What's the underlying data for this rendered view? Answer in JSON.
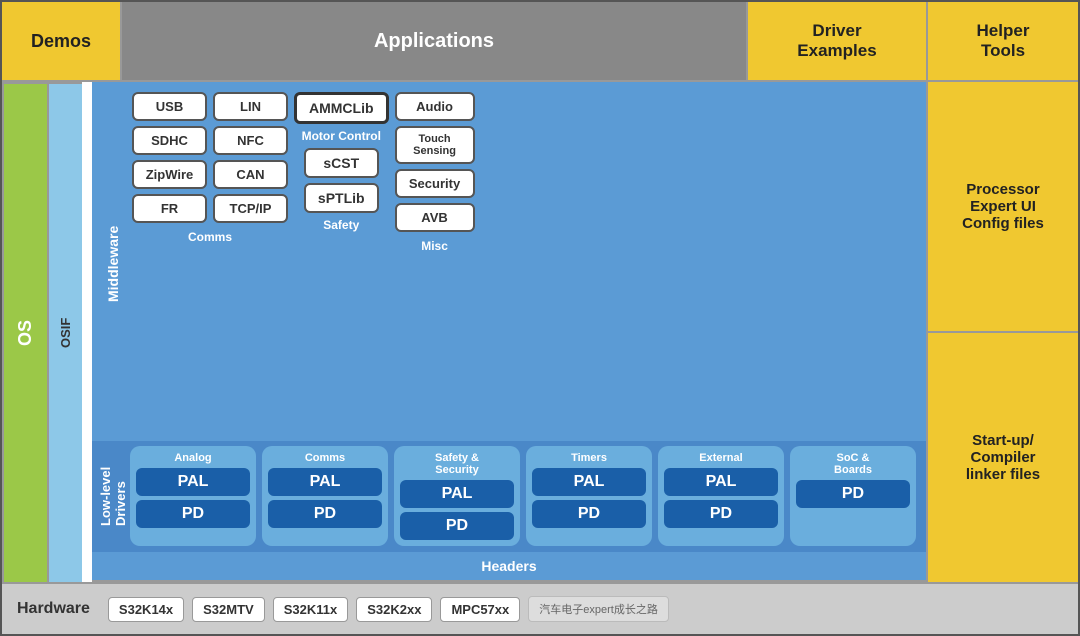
{
  "top": {
    "demos": "Demos",
    "applications": "Applications",
    "driver_examples": "Driver\nExamples",
    "helper_tools": "Helper\nTools"
  },
  "left": {
    "os": "OS",
    "osif": "OSIF"
  },
  "middleware": {
    "label": "Middleware",
    "comms_left": [
      "USB",
      "SDHC",
      "ZipWire",
      "FR"
    ],
    "comms_right": [
      "LIN",
      "NFC",
      "CAN",
      "TCP/IP"
    ],
    "comms_label": "Comms",
    "ammclib": "AMMCLib",
    "motor_control": "Motor Control",
    "scst": "sCST",
    "sptlib": "sPTLib",
    "safety_label": "Safety",
    "audio": "Audio",
    "touch_sensing": "Touch\nSensing",
    "security": "Security",
    "avb": "AVB",
    "misc_label": "Misc"
  },
  "low_level": {
    "label": "Low-level\nDrivers",
    "groups": [
      {
        "name": "Analog",
        "has_pal": true,
        "has_pd": true
      },
      {
        "name": "Comms",
        "has_pal": true,
        "has_pd": true
      },
      {
        "name": "Safety &\nSecurity",
        "has_pal": true,
        "has_pd": true
      },
      {
        "name": "Timers",
        "has_pal": true,
        "has_pd": true
      },
      {
        "name": "External",
        "has_pal": true,
        "has_pd": true
      },
      {
        "name": "SoC &\nBoards",
        "has_pal": false,
        "has_pd": true,
        "pd_only": true
      }
    ],
    "pal": "PAL",
    "pd": "PD"
  },
  "headers": "Headers",
  "right": {
    "processor_expert": "Processor\nExpert UI\nConfig files",
    "startup_compiler": "Start-up/\nCompiler\nlinker files"
  },
  "hardware": {
    "label": "Hardware",
    "chips": [
      "S32K14x",
      "S32MTV",
      "S32K11x",
      "S32K2xx",
      "MPC57xx"
    ],
    "wechat": "汽车电子expert成长之路"
  }
}
